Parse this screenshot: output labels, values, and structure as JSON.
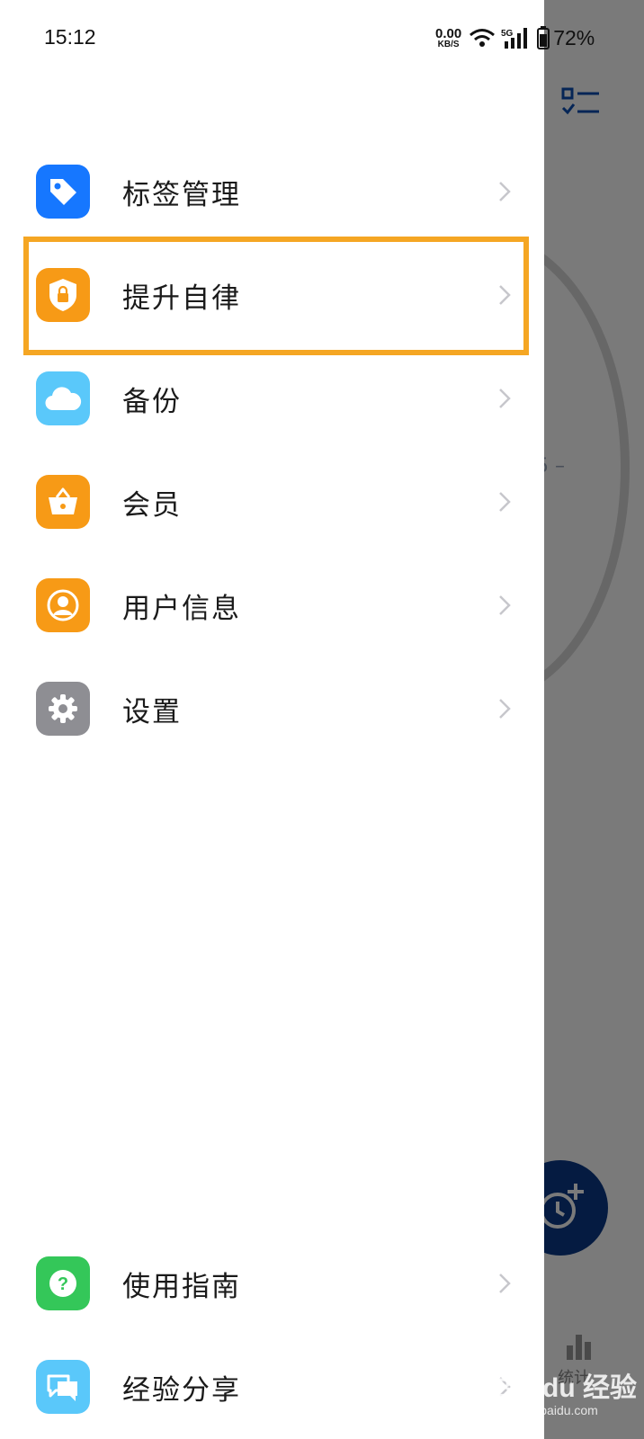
{
  "status_bar": {
    "time": "15:12",
    "net_speed": "0.00",
    "net_unit": "KB/S",
    "signal": "5G",
    "battery": "72%"
  },
  "menu": {
    "items": [
      {
        "label": "标签管理",
        "icon": "tag-icon",
        "color": "#1677ff"
      },
      {
        "label": "提升自律",
        "icon": "shield-lock-icon",
        "color": "#f79a16"
      },
      {
        "label": "备份",
        "icon": "cloud-icon",
        "color": "#5ac8fa"
      },
      {
        "label": "会员",
        "icon": "basket-icon",
        "color": "#f79a16"
      },
      {
        "label": "用户信息",
        "icon": "user-icon",
        "color": "#f79a16"
      },
      {
        "label": "设置",
        "icon": "gear-icon",
        "color": "#8e8e93"
      }
    ],
    "bottom_items": [
      {
        "label": "使用指南",
        "icon": "help-icon",
        "color": "#34c759"
      },
      {
        "label": "经验分享",
        "icon": "chat-icon",
        "color": "#5ac8fa"
      }
    ]
  },
  "highlight_color": "#f5a623",
  "background_app": {
    "stats_label": "统计",
    "fab_color": "#0b3a88"
  },
  "watermark": {
    "text": "Bai du 经验",
    "sub": "jingyan.baidu.com"
  }
}
